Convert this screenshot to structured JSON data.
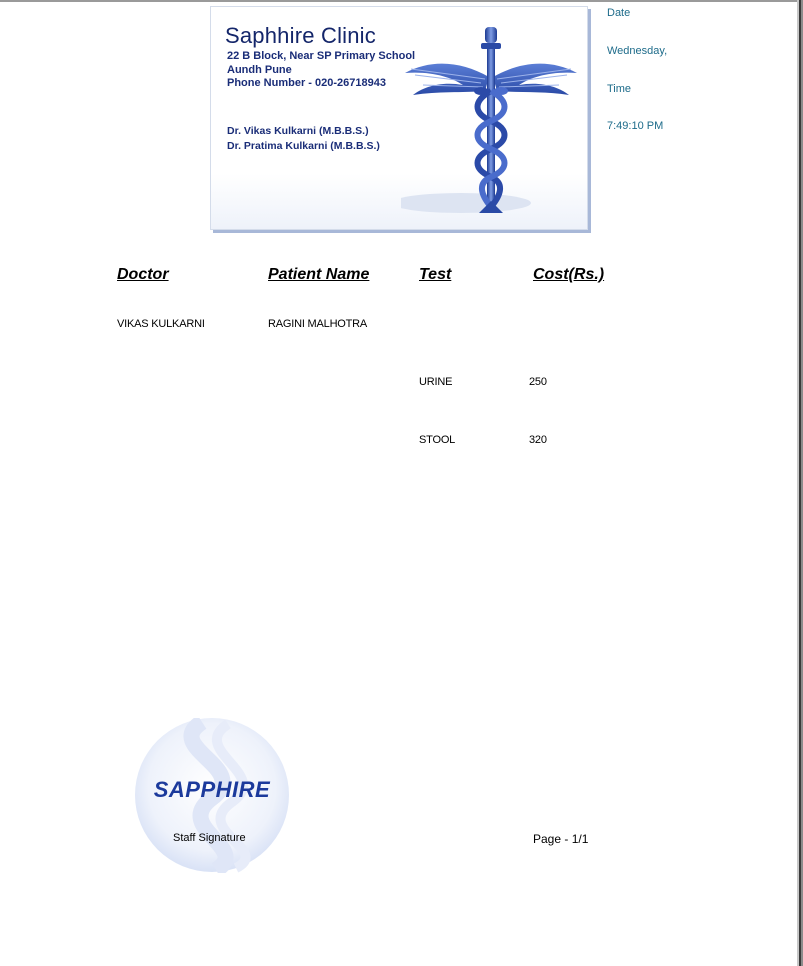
{
  "clinic": {
    "name": "Saphhire Clinic",
    "address_line1": "22 B Block, Near SP Primary School",
    "address_line2": "Aundh Pune",
    "phone": "Phone Number - 020-26718943",
    "doctor1": "Dr. Vikas Kulkarni (M.B.B.S.)",
    "doctor2": "Dr. Pratima Kulkarni (M.B.B.S.)"
  },
  "meta": {
    "date_label": "Date",
    "date_value": "Wednesday,",
    "time_label": "Time",
    "time_value": "7:49:10 PM"
  },
  "table": {
    "headers": {
      "doctor": "Doctor",
      "patient": "Patient Name",
      "test": "Test",
      "cost": "Cost(Rs.)"
    },
    "doctor": "VIKAS KULKARNI",
    "patient": "RAGINI MALHOTRA",
    "tests": [
      {
        "test": "URINE",
        "cost": "250"
      },
      {
        "test": "STOOL",
        "cost": "320"
      }
    ]
  },
  "footer": {
    "logo_text": "SAPPHIRE",
    "staff_signature": "Staff Signature",
    "page": "Page - 1/1"
  },
  "colors": {
    "brand_navy": "#14266a",
    "caduceus_blue": "#3356b8",
    "meta_teal": "#1d6b8a"
  }
}
